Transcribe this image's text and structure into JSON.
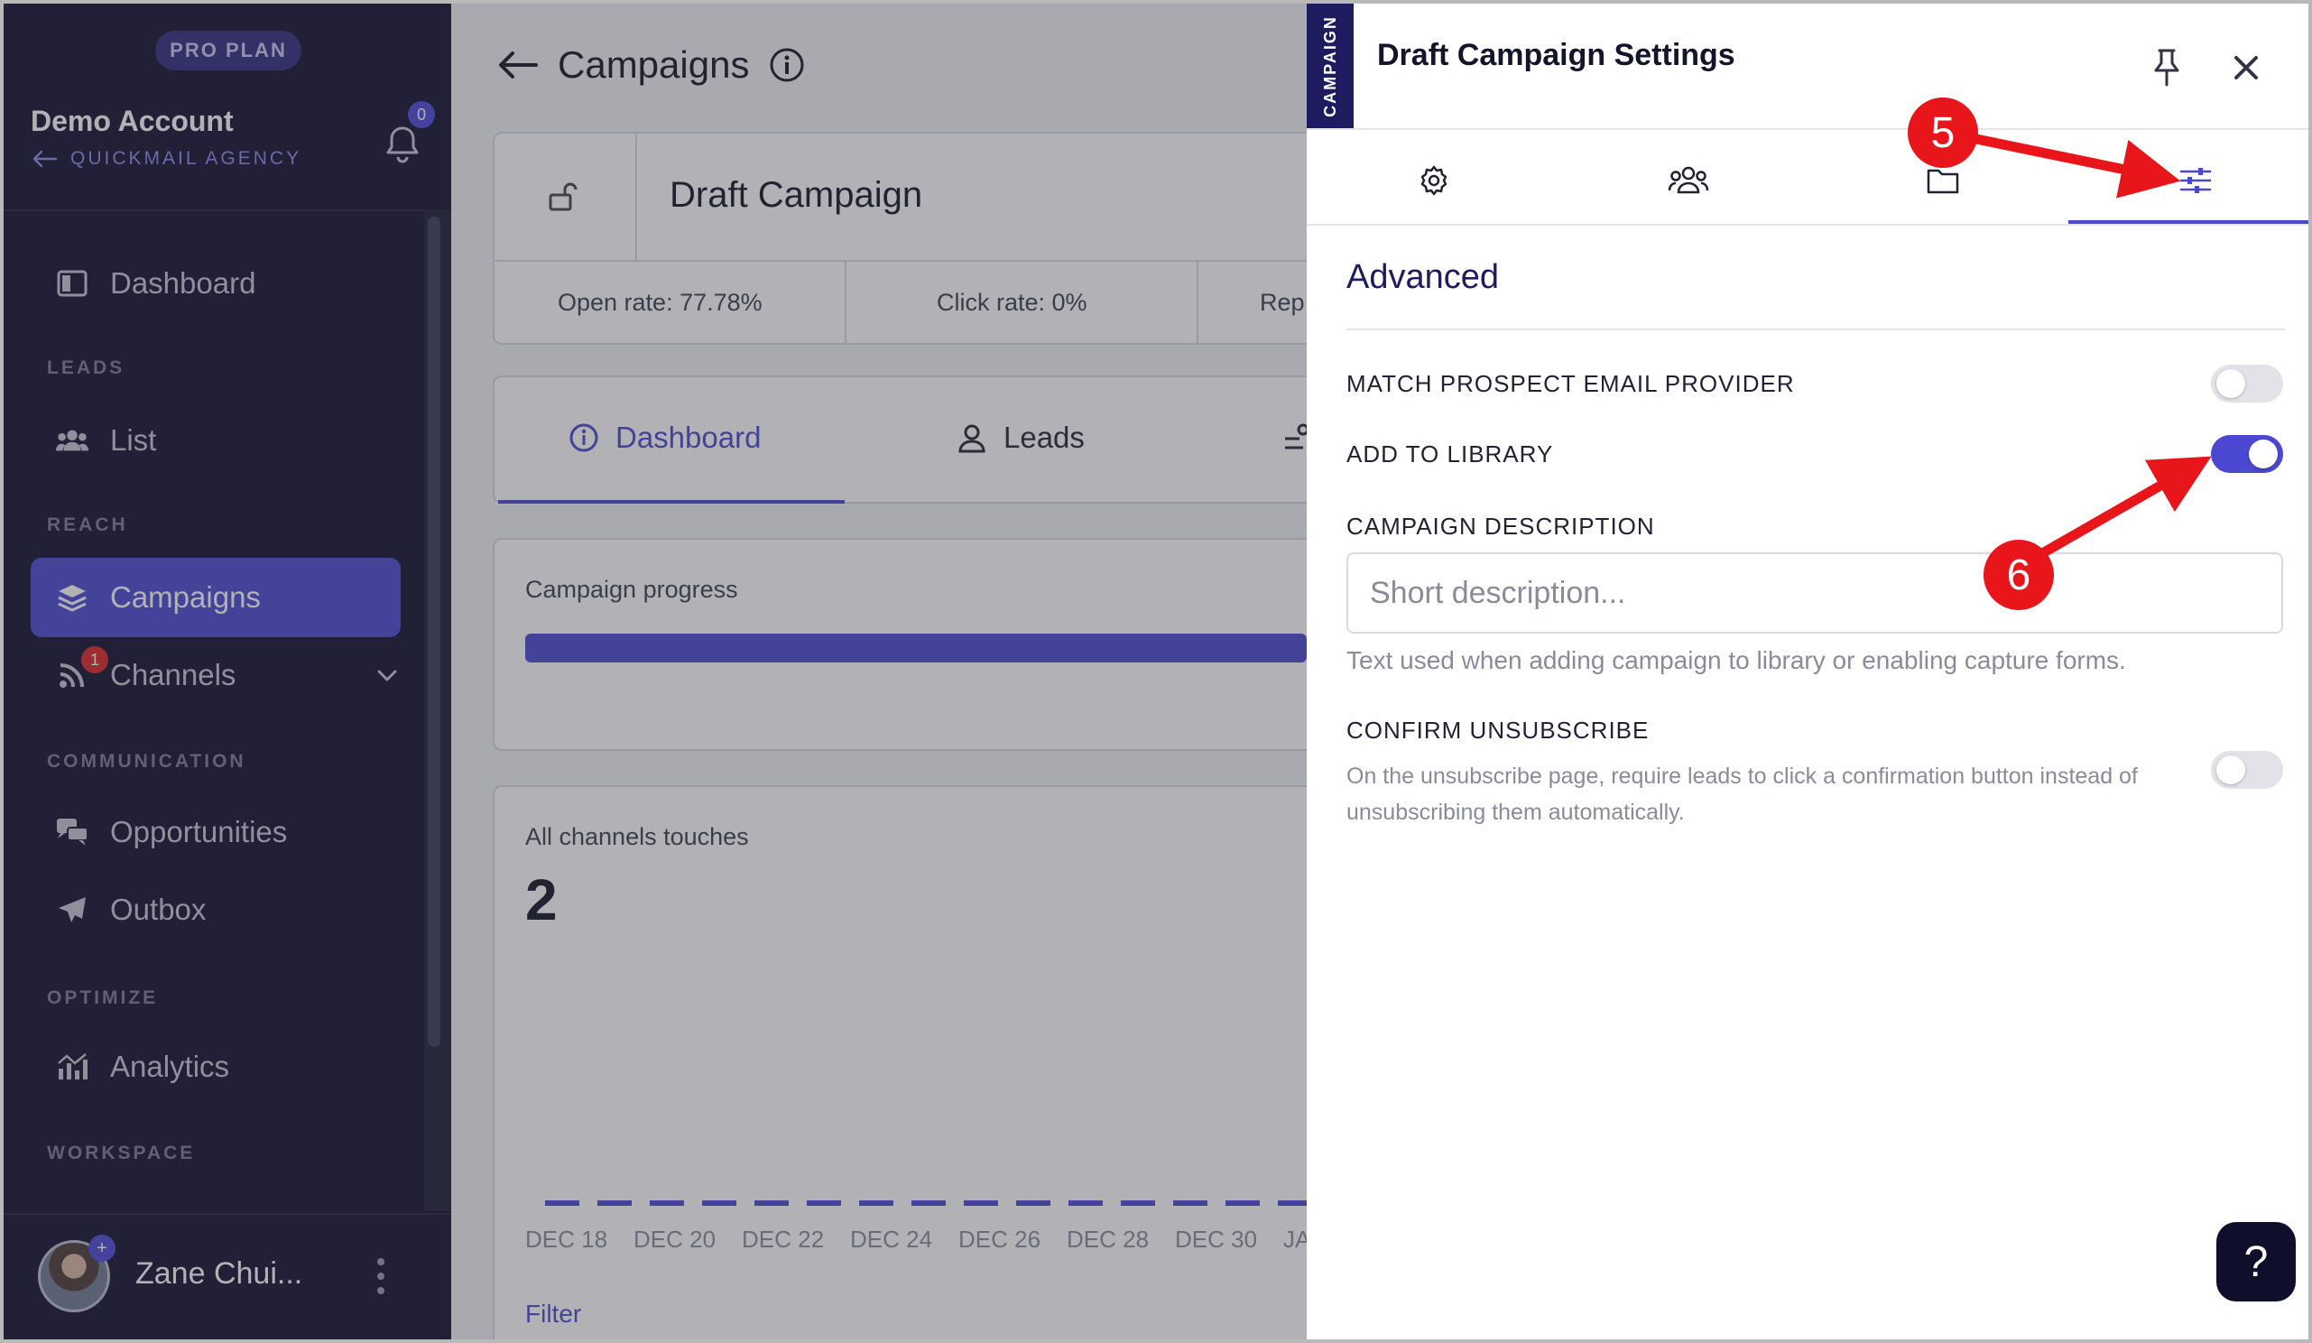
{
  "sidebar": {
    "plan_badge": "PRO PLAN",
    "account_name": "Demo Account",
    "agency": "QUICKMAIL AGENCY",
    "notifications_count": "0",
    "sections": {
      "leads": "LEADS",
      "reach": "REACH",
      "communication": "COMMUNICATION",
      "optimize": "OPTIMIZE",
      "workspace": "WORKSPACE"
    },
    "items": {
      "dashboard": "Dashboard",
      "list": "List",
      "campaigns": "Campaigns",
      "channels": "Channels",
      "opportunities": "Opportunities",
      "outbox": "Outbox",
      "analytics": "Analytics"
    },
    "channels_badge": "1",
    "user_name": "Zane Chui..."
  },
  "main": {
    "title": "Campaigns",
    "campaign_name": "Draft Campaign",
    "stats": {
      "open_rate": "Open rate: 77.78%",
      "click_rate": "Click rate: 0%",
      "reply_partial": "Rep"
    },
    "tabs": {
      "dashboard": "Dashboard",
      "leads": "Leads"
    },
    "progress_label": "Campaign progress",
    "touches_label": "All channels touches",
    "touches_value": "2",
    "dates": [
      "DEC 18",
      "DEC 20",
      "DEC 22",
      "DEC 24",
      "DEC 26",
      "DEC 28",
      "DEC 30",
      "JA"
    ],
    "filter_label": "Filter"
  },
  "panel": {
    "side_label": "CAMPAIGN",
    "title": "Draft Campaign Settings",
    "active_tab": "advanced",
    "section_title": "Advanced",
    "match_provider": {
      "label": "MATCH PROSPECT EMAIL PROVIDER",
      "enabled": false
    },
    "add_to_library": {
      "label": "ADD TO LIBRARY",
      "enabled": true
    },
    "campaign_description": {
      "label": "CAMPAIGN DESCRIPTION",
      "value": "",
      "placeholder": "Short description...",
      "help": "Text used when adding campaign to library or enabling capture forms."
    },
    "confirm_unsubscribe": {
      "label": "CONFIRM UNSUBSCRIBE",
      "help": "On the unsubscribe page, require leads to click a confirmation button instead of unsubscribing them automatically.",
      "enabled": false
    },
    "help_button": "?"
  },
  "annotations": {
    "step_5": "5",
    "step_6": "6",
    "color": "#e8151b"
  },
  "colors": {
    "accent": "#4a48d0",
    "sidebar_bg": "#0f0e2b"
  }
}
